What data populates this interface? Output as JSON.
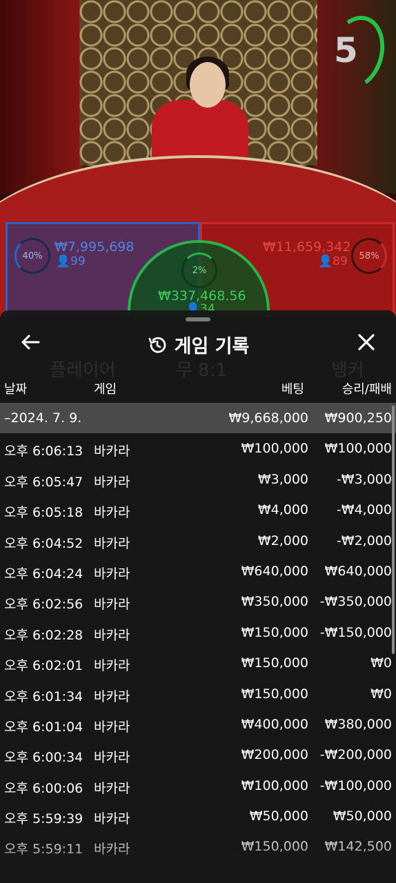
{
  "stream": {
    "timer": "5",
    "player": {
      "percent": "40%",
      "amount": "₩7,995,698",
      "count": "99"
    },
    "banker": {
      "percent": "58%",
      "amount": "₩11,659,342",
      "count": "89"
    },
    "tie": {
      "percent": "2%",
      "amount": "₩337,468.56",
      "count": "34"
    },
    "colors": {
      "player": "#2b63c7",
      "banker": "#c92a2a",
      "tie": "#2bb24c"
    }
  },
  "background_labels": {
    "player": "플레이어",
    "tie": "무 8:1",
    "banker": "뱅커"
  },
  "history": {
    "title": "게임 기록",
    "icons": {
      "back": "arrow-left-icon",
      "history": "history-clock-icon",
      "close": "close-x-icon"
    },
    "columns": {
      "date": "날짜",
      "game": "게임",
      "bet": "베팅",
      "win_loss": "승리/패배"
    },
    "date_row": {
      "date": "–2024. 7. 9.",
      "bet": "₩9,668,000",
      "win_loss": "₩900,250"
    },
    "rows": [
      {
        "time": "오후 6:06:13",
        "game": "바카라",
        "bet": "₩100,000",
        "result": "₩100,000"
      },
      {
        "time": "오후 6:05:47",
        "game": "바카라",
        "bet": "₩3,000",
        "result": "-₩3,000"
      },
      {
        "time": "오후 6:05:18",
        "game": "바카라",
        "bet": "₩4,000",
        "result": "-₩4,000"
      },
      {
        "time": "오후 6:04:52",
        "game": "바카라",
        "bet": "₩2,000",
        "result": "-₩2,000"
      },
      {
        "time": "오후 6:04:24",
        "game": "바카라",
        "bet": "₩640,000",
        "result": "₩640,000"
      },
      {
        "time": "오후 6:02:56",
        "game": "바카라",
        "bet": "₩350,000",
        "result": "-₩350,000"
      },
      {
        "time": "오후 6:02:28",
        "game": "바카라",
        "bet": "₩150,000",
        "result": "-₩150,000"
      },
      {
        "time": "오후 6:02:01",
        "game": "바카라",
        "bet": "₩150,000",
        "result": "₩0"
      },
      {
        "time": "오후 6:01:34",
        "game": "바카라",
        "bet": "₩150,000",
        "result": "₩0"
      },
      {
        "time": "오후 6:01:04",
        "game": "바카라",
        "bet": "₩400,000",
        "result": "₩380,000"
      },
      {
        "time": "오후 6:00:34",
        "game": "바카라",
        "bet": "₩200,000",
        "result": "-₩200,000"
      },
      {
        "time": "오후 6:00:06",
        "game": "바카라",
        "bet": "₩100,000",
        "result": "-₩100,000"
      },
      {
        "time": "오후 5:59:39",
        "game": "바카라",
        "bet": "₩50,000",
        "result": "₩50,000"
      },
      {
        "time": "오후 5:59:11",
        "game": "바카라",
        "bet": "₩150,000",
        "result": "₩142,500"
      }
    ]
  }
}
